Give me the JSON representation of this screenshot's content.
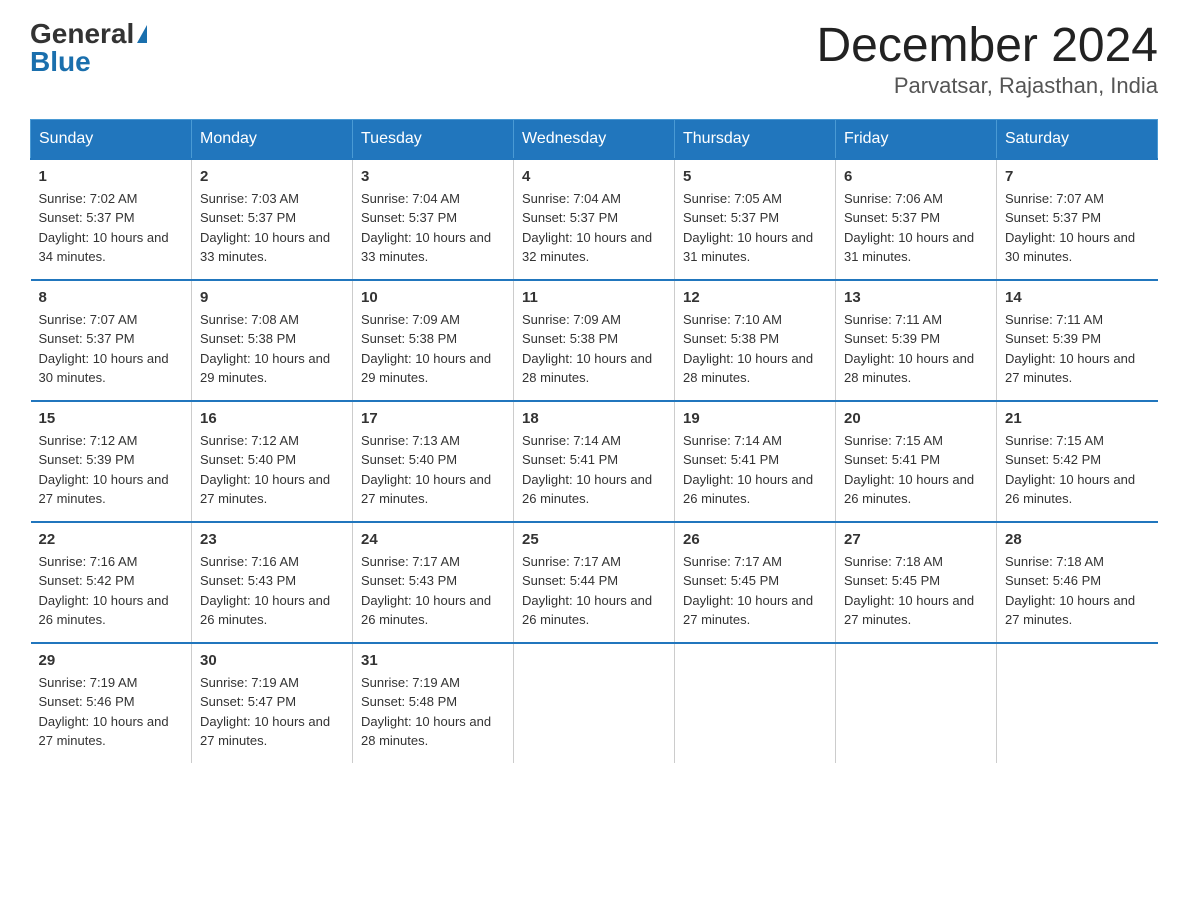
{
  "header": {
    "logo_general": "General",
    "logo_blue": "Blue",
    "title": "December 2024",
    "subtitle": "Parvatsar, Rajasthan, India"
  },
  "days_of_week": [
    "Sunday",
    "Monday",
    "Tuesday",
    "Wednesday",
    "Thursday",
    "Friday",
    "Saturday"
  ],
  "weeks": [
    [
      {
        "num": "1",
        "sunrise": "7:02 AM",
        "sunset": "5:37 PM",
        "daylight": "10 hours and 34 minutes."
      },
      {
        "num": "2",
        "sunrise": "7:03 AM",
        "sunset": "5:37 PM",
        "daylight": "10 hours and 33 minutes."
      },
      {
        "num": "3",
        "sunrise": "7:04 AM",
        "sunset": "5:37 PM",
        "daylight": "10 hours and 33 minutes."
      },
      {
        "num": "4",
        "sunrise": "7:04 AM",
        "sunset": "5:37 PM",
        "daylight": "10 hours and 32 minutes."
      },
      {
        "num": "5",
        "sunrise": "7:05 AM",
        "sunset": "5:37 PM",
        "daylight": "10 hours and 31 minutes."
      },
      {
        "num": "6",
        "sunrise": "7:06 AM",
        "sunset": "5:37 PM",
        "daylight": "10 hours and 31 minutes."
      },
      {
        "num": "7",
        "sunrise": "7:07 AM",
        "sunset": "5:37 PM",
        "daylight": "10 hours and 30 minutes."
      }
    ],
    [
      {
        "num": "8",
        "sunrise": "7:07 AM",
        "sunset": "5:37 PM",
        "daylight": "10 hours and 30 minutes."
      },
      {
        "num": "9",
        "sunrise": "7:08 AM",
        "sunset": "5:38 PM",
        "daylight": "10 hours and 29 minutes."
      },
      {
        "num": "10",
        "sunrise": "7:09 AM",
        "sunset": "5:38 PM",
        "daylight": "10 hours and 29 minutes."
      },
      {
        "num": "11",
        "sunrise": "7:09 AM",
        "sunset": "5:38 PM",
        "daylight": "10 hours and 28 minutes."
      },
      {
        "num": "12",
        "sunrise": "7:10 AM",
        "sunset": "5:38 PM",
        "daylight": "10 hours and 28 minutes."
      },
      {
        "num": "13",
        "sunrise": "7:11 AM",
        "sunset": "5:39 PM",
        "daylight": "10 hours and 28 minutes."
      },
      {
        "num": "14",
        "sunrise": "7:11 AM",
        "sunset": "5:39 PM",
        "daylight": "10 hours and 27 minutes."
      }
    ],
    [
      {
        "num": "15",
        "sunrise": "7:12 AM",
        "sunset": "5:39 PM",
        "daylight": "10 hours and 27 minutes."
      },
      {
        "num": "16",
        "sunrise": "7:12 AM",
        "sunset": "5:40 PM",
        "daylight": "10 hours and 27 minutes."
      },
      {
        "num": "17",
        "sunrise": "7:13 AM",
        "sunset": "5:40 PM",
        "daylight": "10 hours and 27 minutes."
      },
      {
        "num": "18",
        "sunrise": "7:14 AM",
        "sunset": "5:41 PM",
        "daylight": "10 hours and 26 minutes."
      },
      {
        "num": "19",
        "sunrise": "7:14 AM",
        "sunset": "5:41 PM",
        "daylight": "10 hours and 26 minutes."
      },
      {
        "num": "20",
        "sunrise": "7:15 AM",
        "sunset": "5:41 PM",
        "daylight": "10 hours and 26 minutes."
      },
      {
        "num": "21",
        "sunrise": "7:15 AM",
        "sunset": "5:42 PM",
        "daylight": "10 hours and 26 minutes."
      }
    ],
    [
      {
        "num": "22",
        "sunrise": "7:16 AM",
        "sunset": "5:42 PM",
        "daylight": "10 hours and 26 minutes."
      },
      {
        "num": "23",
        "sunrise": "7:16 AM",
        "sunset": "5:43 PM",
        "daylight": "10 hours and 26 minutes."
      },
      {
        "num": "24",
        "sunrise": "7:17 AM",
        "sunset": "5:43 PM",
        "daylight": "10 hours and 26 minutes."
      },
      {
        "num": "25",
        "sunrise": "7:17 AM",
        "sunset": "5:44 PM",
        "daylight": "10 hours and 26 minutes."
      },
      {
        "num": "26",
        "sunrise": "7:17 AM",
        "sunset": "5:45 PM",
        "daylight": "10 hours and 27 minutes."
      },
      {
        "num": "27",
        "sunrise": "7:18 AM",
        "sunset": "5:45 PM",
        "daylight": "10 hours and 27 minutes."
      },
      {
        "num": "28",
        "sunrise": "7:18 AM",
        "sunset": "5:46 PM",
        "daylight": "10 hours and 27 minutes."
      }
    ],
    [
      {
        "num": "29",
        "sunrise": "7:19 AM",
        "sunset": "5:46 PM",
        "daylight": "10 hours and 27 minutes."
      },
      {
        "num": "30",
        "sunrise": "7:19 AM",
        "sunset": "5:47 PM",
        "daylight": "10 hours and 27 minutes."
      },
      {
        "num": "31",
        "sunrise": "7:19 AM",
        "sunset": "5:48 PM",
        "daylight": "10 hours and 28 minutes."
      },
      null,
      null,
      null,
      null
    ]
  ],
  "labels": {
    "sunrise": "Sunrise:",
    "sunset": "Sunset:",
    "daylight": "Daylight:"
  }
}
